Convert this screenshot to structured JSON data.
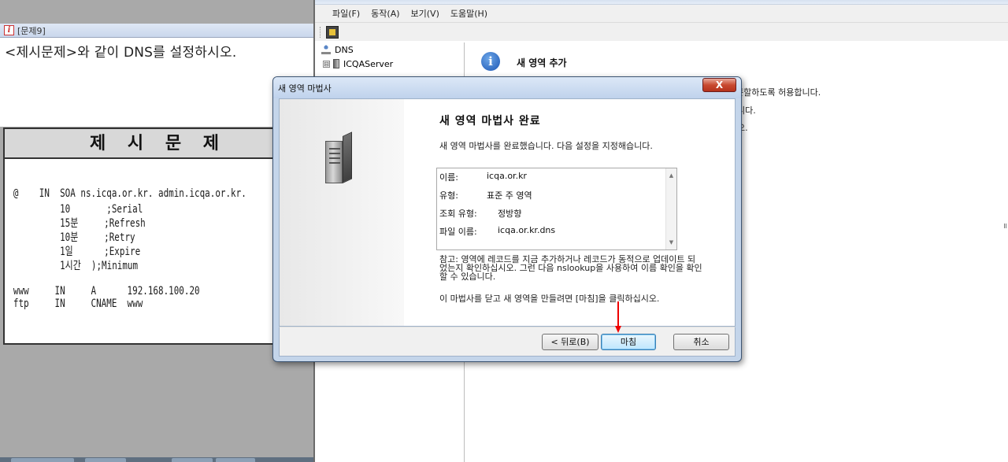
{
  "left_panel": {
    "window_title": "[문제9]",
    "question": "<제시문제>와 같이 DNS를 설정하시오.",
    "problem_title": "제 시 문 제",
    "problem_lines": [
      "@    IN  SOA ns.icqa.or.kr. admin.icqa.or.kr.",
      "         10       ;Serial",
      "         15분     ;Refresh",
      "         10분     ;Retry",
      "         1일      ;Expire",
      "         1시간  );Minimum",
      "www     IN     A      192.168.100.20",
      "ftp     IN     CNAME  www"
    ]
  },
  "dns_manager": {
    "menu": [
      "파일(F)",
      "동작(A)",
      "보기(V)",
      "도움말(H)"
    ],
    "tree": {
      "root": "DNS",
      "server": "ICQAServer",
      "server_expander": "⊟"
    },
    "info_title": "새 영역 추가",
    "info_fragments": [
      "분할하도록 허용합니다.",
      "니다.",
      "오."
    ]
  },
  "wizard": {
    "title": "새 영역 마법사",
    "close": "X",
    "heading": "새 영역 마법사 완료",
    "intro": "새 영역 마법사를 완료했습니다. 다음 설정을 지정해습니다.",
    "summary": [
      {
        "label": "이름:",
        "value": "icqa.or.kr"
      },
      {
        "label": "유형:",
        "value": "표준 주 영역"
      },
      {
        "label": "조회 유형:",
        "value": "정방향"
      },
      {
        "label": "파일 이름:",
        "value": "icqa.or.kr.dns"
      }
    ],
    "note": "참고: 영역에 레코드를 지금 추가하거나 레코드가 동적으로 업데이트 되었는지 확인하십시오. 그런 다음 nslookup을 사용하여 이름 확인을 확인할 수 있습니다.",
    "finish_hint": "이 마법사를 닫고 새 영역을 만들려면 [마침]을 클릭하십시오.",
    "buttons": {
      "back": "< 뒤로(B)",
      "finish": "마침",
      "cancel": "취소"
    }
  }
}
